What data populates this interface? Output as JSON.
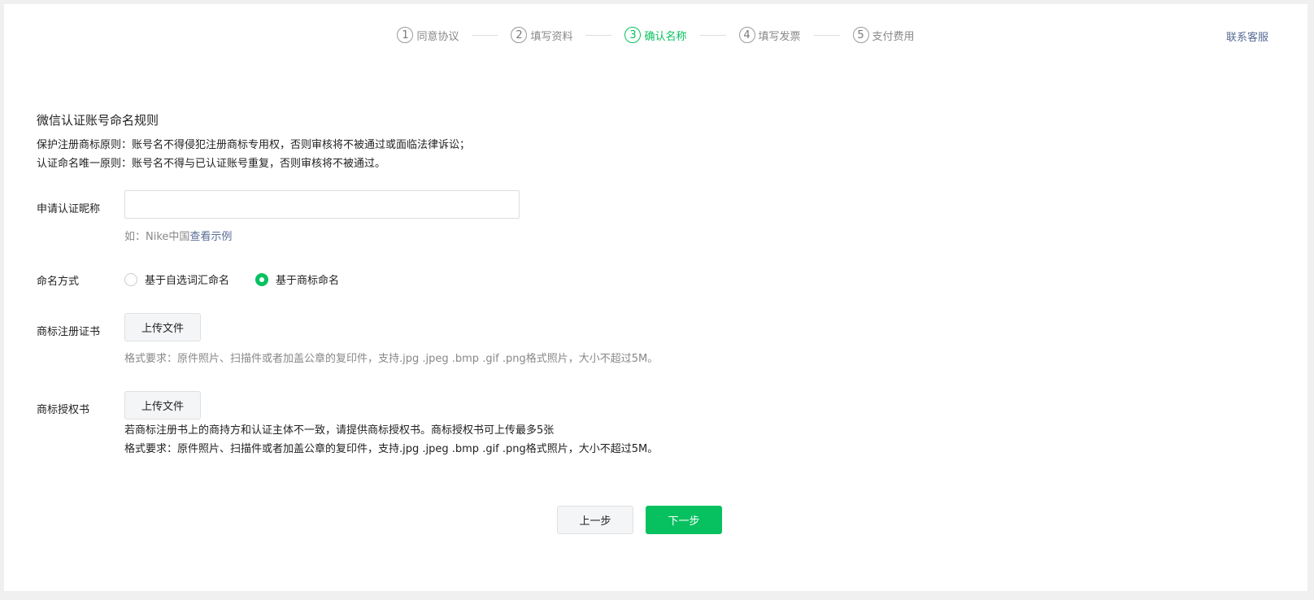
{
  "steps": [
    {
      "num": "1",
      "label": "同意协议"
    },
    {
      "num": "2",
      "label": "填写资料"
    },
    {
      "num": "3",
      "label": "确认名称"
    },
    {
      "num": "4",
      "label": "填写发票"
    },
    {
      "num": "5",
      "label": "支付费用"
    }
  ],
  "active_step": 3,
  "contact": "联系客服",
  "rules": {
    "title": "微信认证账号命名规则",
    "line1": "保护注册商标原则：账号名不得侵犯注册商标专用权，否则审核将不被通过或面临法律诉讼；",
    "line2": "认证命名唯一原则：账号名不得与已认证账号重复，否则审核将不被通过。"
  },
  "form": {
    "nickname_label": "申请认证昵称",
    "nickname_value": "",
    "nickname_hint_prefix": "如：Nike中国",
    "nickname_hint_link": "查看示例",
    "naming_label": "命名方式",
    "naming_options": [
      "基于自选词汇命名",
      "基于商标命名"
    ],
    "naming_selected": "基于商标命名",
    "cert_label": "商标注册证书",
    "upload_label": "上传文件",
    "cert_hint": "格式要求：原件照片、扫描件或者加盖公章的复印件，支持.jpg .jpeg .bmp .gif .png格式照片，大小不超过5M。",
    "auth_label": "商标授权书",
    "auth_note": "若商标注册书上的商持方和认证主体不一致，请提供商标授权书。商标授权书可上传最多5张",
    "auth_hint": "格式要求：原件照片、扫描件或者加盖公章的复印件，支持.jpg .jpeg .bmp .gif .png格式照片，大小不超过5M。"
  },
  "buttons": {
    "prev": "上一步",
    "next": "下一步"
  },
  "colors": {
    "accent": "#07c160",
    "link": "#576b95"
  }
}
